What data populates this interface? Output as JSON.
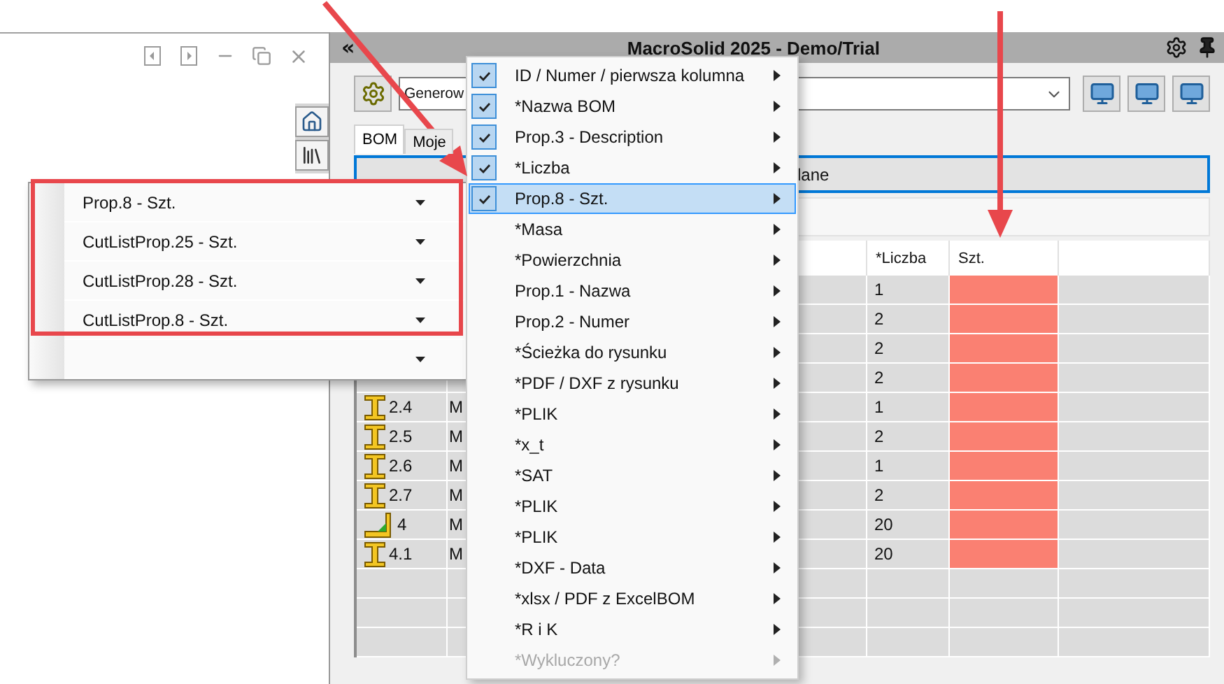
{
  "window": {
    "title": "MacroSolid 2025 - Demo/Trial",
    "collapse": "«"
  },
  "toolbar": {
    "dropdown_value": "Generow"
  },
  "tabs": [
    {
      "label": "BOM",
      "selected": true
    },
    {
      "label": "Moje",
      "selected": false
    }
  ],
  "filter_field": {
    "value": "lane"
  },
  "table": {
    "columns": [
      "*Liczba",
      "Szt."
    ],
    "rows": [
      {
        "count": "1",
        "flagged": true
      },
      {
        "count": "2",
        "flagged": true
      },
      {
        "count": "2",
        "flagged": true
      },
      {
        "count": "2",
        "flagged": true
      },
      {
        "kind": "beam",
        "id": "2.4",
        "column_2": "M",
        "count": "1",
        "flagged": true
      },
      {
        "kind": "beam",
        "id": "2.5",
        "column_2": "M",
        "count": "2",
        "flagged": true
      },
      {
        "kind": "beam",
        "id": "2.6",
        "column_2": "M",
        "count": "1",
        "flagged": true
      },
      {
        "kind": "beam",
        "id": "2.7",
        "column_2": "M",
        "count": "2",
        "flagged": true
      },
      {
        "kind": "angle",
        "id": "4",
        "column_2": "M",
        "count": "20",
        "flagged": true
      },
      {
        "kind": "beam",
        "id": "4.1",
        "column_2": "M",
        "count": "20",
        "flagged": true
      }
    ]
  },
  "column_menu": {
    "items": [
      {
        "label": "ID / Numer / pierwsza kolumna",
        "checked": true,
        "selected": false,
        "disabled": false
      },
      {
        "label": "*Nazwa BOM",
        "checked": true,
        "selected": false,
        "disabled": false
      },
      {
        "label": "Prop.3 - Description",
        "checked": true,
        "selected": false,
        "disabled": false
      },
      {
        "label": "*Liczba",
        "checked": true,
        "selected": false,
        "disabled": false
      },
      {
        "label": "Prop.8 - Szt.",
        "checked": true,
        "selected": true,
        "disabled": false
      },
      {
        "label": "*Masa",
        "checked": false,
        "selected": false,
        "disabled": false
      },
      {
        "label": "*Powierzchnia",
        "checked": false,
        "selected": false,
        "disabled": false
      },
      {
        "label": "Prop.1 - Nazwa",
        "checked": false,
        "selected": false,
        "disabled": false
      },
      {
        "label": "Prop.2 - Numer",
        "checked": false,
        "selected": false,
        "disabled": false
      },
      {
        "label": "*Ścieżka do rysunku",
        "checked": false,
        "selected": false,
        "disabled": false
      },
      {
        "label": "*PDF / DXF z rysunku",
        "checked": false,
        "selected": false,
        "disabled": false
      },
      {
        "label": "*PLIK",
        "checked": false,
        "selected": false,
        "disabled": false
      },
      {
        "label": "*x_t",
        "checked": false,
        "selected": false,
        "disabled": false
      },
      {
        "label": "*SAT",
        "checked": false,
        "selected": false,
        "disabled": false
      },
      {
        "label": "*PLIK",
        "checked": false,
        "selected": false,
        "disabled": false
      },
      {
        "label": "*PLIK",
        "checked": false,
        "selected": false,
        "disabled": false
      },
      {
        "label": "*DXF - Data",
        "checked": false,
        "selected": false,
        "disabled": false
      },
      {
        "label": "*xlsx / PDF z ExcelBOM",
        "checked": false,
        "selected": false,
        "disabled": false
      },
      {
        "label": "*R i K",
        "checked": false,
        "selected": false,
        "disabled": false
      },
      {
        "label": "*Wykluczony?",
        "checked": false,
        "selected": false,
        "disabled": true
      }
    ]
  },
  "dropdown_list": {
    "items": [
      {
        "label": "Prop.8 - Szt."
      },
      {
        "label": "CutListProp.25 - Szt."
      },
      {
        "label": "CutListProp.28 - Szt."
      },
      {
        "label": "CutListProp.8 - Szt."
      }
    ]
  }
}
